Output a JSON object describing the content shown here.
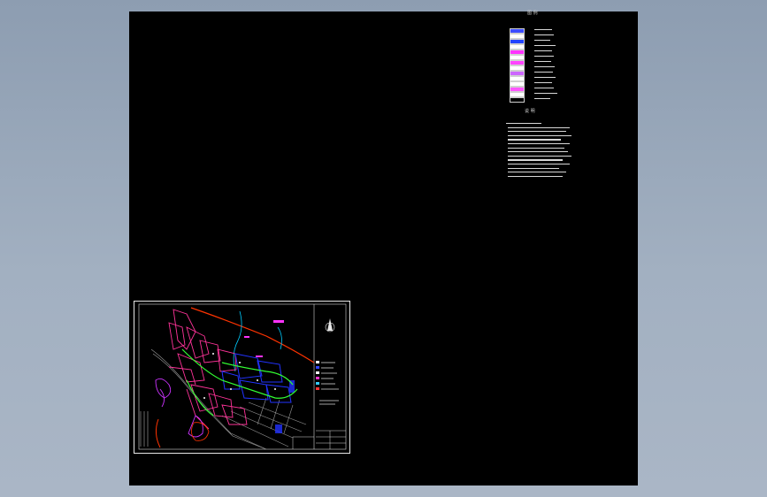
{
  "drawing": {
    "legend_label": "图 例",
    "notes_label": "说 明",
    "compass_symbol": "N",
    "legend_colors": [
      "#3c4cff",
      "#ffffff",
      "#2244ff",
      "#ffffff",
      "#ff33ff",
      "#ffffff",
      "#ff44ff",
      "#ffffff",
      "#cc66ff",
      "#ffffff",
      "#ffffff",
      "#ff55ff",
      "#ffffff",
      "#000000"
    ],
    "road_colors": {
      "main_road": "#ff3399",
      "green_belt": "#33ff33",
      "blue_block": "#2233ff",
      "river": "#00ccff",
      "boundary": "#ff3300"
    }
  }
}
